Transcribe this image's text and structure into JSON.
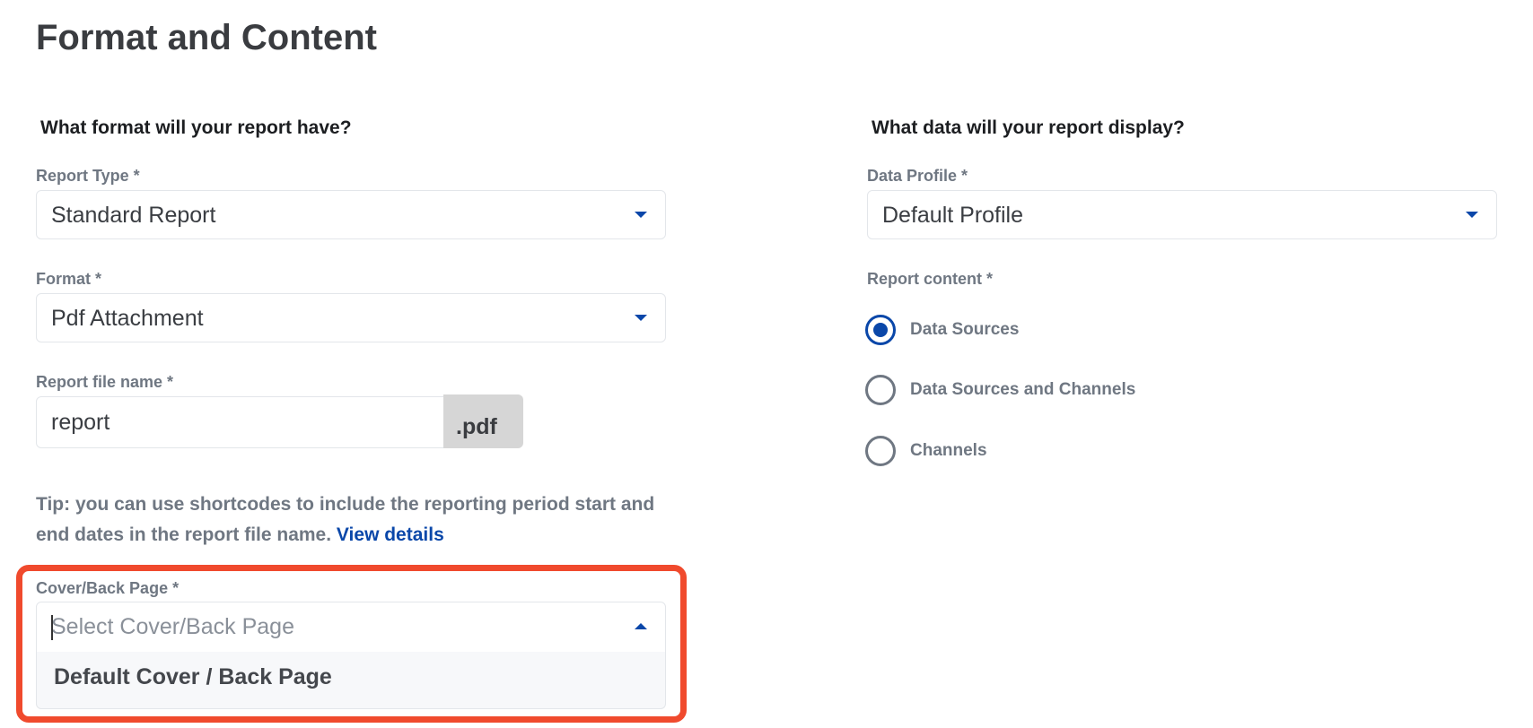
{
  "page": {
    "title": "Format and Content"
  },
  "left": {
    "heading": "What format will your report have?",
    "report_type": {
      "label": "Report Type *",
      "value": "Standard Report"
    },
    "format": {
      "label": "Format *",
      "value": "Pdf Attachment"
    },
    "file_name": {
      "label": "Report file name *",
      "value": "report",
      "suffix": ".pdf"
    },
    "tip": {
      "text": "Tip: you can use shortcodes to include the reporting period start and end dates in the report file name.",
      "link": "View details"
    },
    "cover_page": {
      "label": "Cover/Back Page *",
      "placeholder": "Select Cover/Back Page",
      "options": [
        "Default Cover / Back Page"
      ]
    }
  },
  "right": {
    "heading": "What data will your report display?",
    "data_profile": {
      "label": "Data Profile *",
      "value": "Default Profile"
    },
    "report_content": {
      "label": "Report content *",
      "options": [
        {
          "label": "Data Sources",
          "checked": true
        },
        {
          "label": "Data Sources and Channels",
          "checked": false
        },
        {
          "label": "Channels",
          "checked": false
        }
      ]
    }
  },
  "colors": {
    "accent": "#0a47a9",
    "highlight": "#f04a2d",
    "label": "#6f7782"
  }
}
